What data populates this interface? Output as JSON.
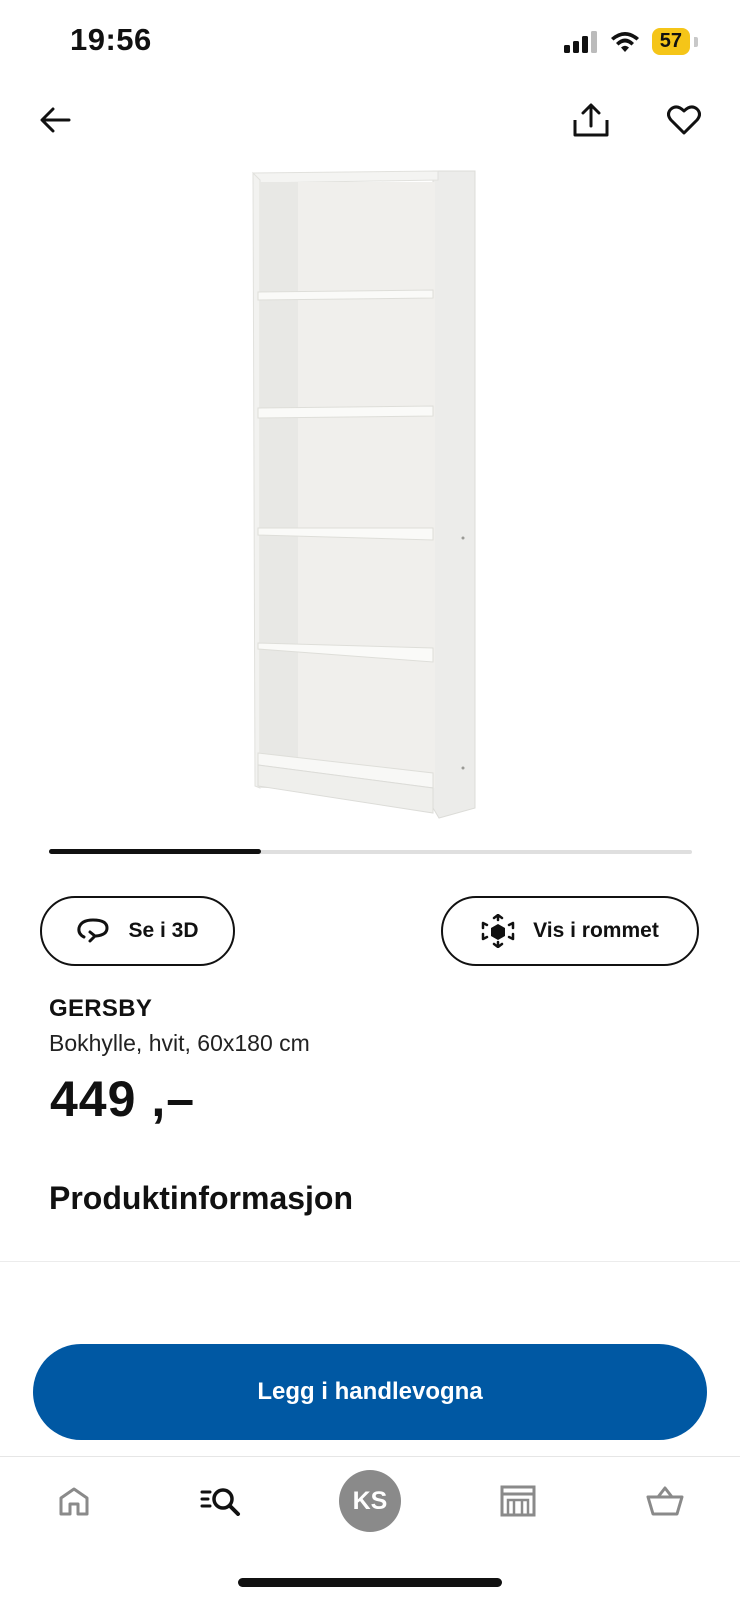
{
  "status_bar": {
    "time": "19:56",
    "battery": "57"
  },
  "top_nav": {
    "back_icon": "arrow-left-icon",
    "share_icon": "share-icon",
    "favorite_icon": "heart-icon"
  },
  "gallery": {
    "progress": 0.33
  },
  "actions": {
    "view_3d_label": "Se i 3D",
    "view_in_room_label": "Vis i rommet"
  },
  "product": {
    "name": "GERSBY",
    "description": "Bokhylle, hvit, 60x180 cm",
    "price": "449 ,–"
  },
  "sections": {
    "product_info": "Produktinformasjon"
  },
  "cta": {
    "label": "Legg i handlevogna",
    "color": "#0058a3"
  },
  "tab_bar": {
    "items": [
      {
        "name": "home",
        "icon": "home-icon"
      },
      {
        "name": "search",
        "icon": "search-list-icon"
      },
      {
        "name": "profile",
        "initials": "KS"
      },
      {
        "name": "store",
        "icon": "store-icon"
      },
      {
        "name": "cart",
        "icon": "basket-icon"
      }
    ]
  }
}
